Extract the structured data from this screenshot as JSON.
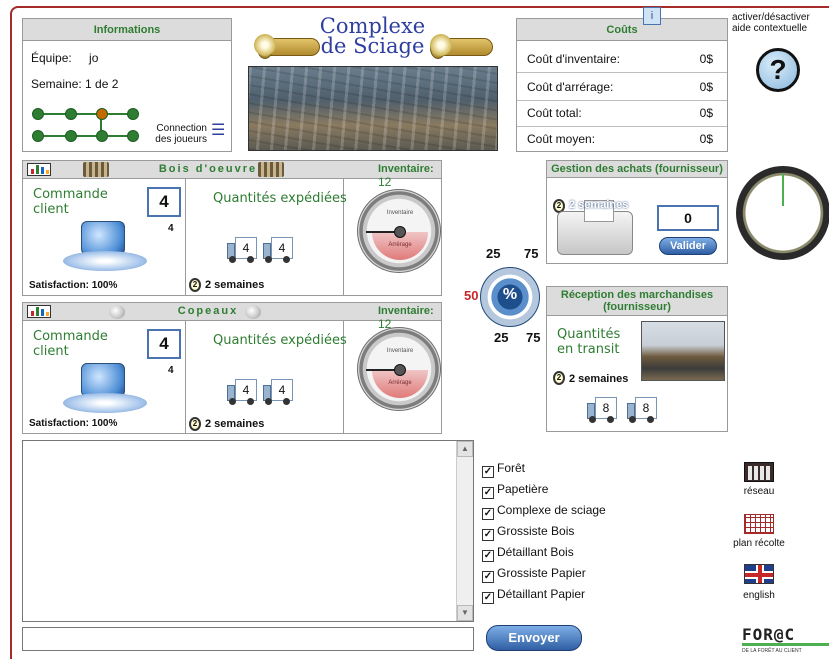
{
  "info": {
    "title": "Informations",
    "team_label": "Équipe:",
    "team": "jo",
    "week_label": "Semaine:",
    "week": "1 de 2",
    "players_link": "Connection des joueurs"
  },
  "app_title": "Complexe de Sciage",
  "costs": {
    "title": "Coûts",
    "rows": [
      {
        "label": "Coût d'inventaire:",
        "value": "0$"
      },
      {
        "label": "Coût d'arrérage:",
        "value": "0$"
      },
      {
        "label": "Coût total:",
        "value": "0$"
      },
      {
        "label": "Coût moyen:",
        "value": "0$"
      }
    ]
  },
  "help": {
    "label": "activer/désactiver aide contextuelle",
    "symbol": "?"
  },
  "products": [
    {
      "name": "Bois d'oeuvre",
      "inventory_label": "Inventaire:",
      "inventory": "12",
      "command_title": "Commande client",
      "command_value": "4",
      "command_small": "4",
      "satisfaction": "Satisfaction: 100%",
      "shipped_title": "Quantités expédiées",
      "trucks": [
        "4",
        "4"
      ],
      "delay": "2 semaines",
      "gauge_top": "Inventaire",
      "gauge_bottom": "Arrérage"
    },
    {
      "name": "Copeaux",
      "inventory_label": "Inventaire:",
      "inventory": "12",
      "command_title": "Commande client",
      "command_value": "4",
      "command_small": "4",
      "satisfaction": "Satisfaction: 100%",
      "shipped_title": "Quantités expédiées",
      "trucks": [
        "4",
        "4"
      ],
      "delay": "2 semaines",
      "gauge_top": "Inventaire",
      "gauge_bottom": "Arrérage"
    }
  ],
  "dial": {
    "symbol": "%",
    "top_left": "25",
    "top_right": "75",
    "left": "50",
    "bottom_left": "25",
    "bottom_right": "75"
  },
  "purchasing": {
    "title": "Gestion des achats (fournisseur)",
    "delay": "2 semaines",
    "order_value": "0",
    "validate": "Valider"
  },
  "receiving": {
    "title": "Réception des marchandises (fournisseur)",
    "transit_title": "Quantités en transit",
    "delay": "2 semaines",
    "trucks": [
      "8",
      "8"
    ]
  },
  "chat": {
    "send": "Envoyer",
    "input_value": ""
  },
  "recipients": [
    {
      "label": "Forêt",
      "checked": true
    },
    {
      "label": "Papetière",
      "checked": true
    },
    {
      "label": "Complexe de sciage",
      "checked": true
    },
    {
      "label": "Grossiste Bois",
      "checked": true
    },
    {
      "label": "Détaillant Bois",
      "checked": true
    },
    {
      "label": "Grossiste Papier",
      "checked": true
    },
    {
      "label": "Détaillant Papier",
      "checked": true
    }
  ],
  "side": {
    "network": "réseau",
    "harvest": "plan récolte",
    "language": "english"
  },
  "logo": {
    "text": "FOR@C",
    "tagline": "DE LA FORÊT AU CLIENT"
  },
  "colors": {
    "accent_green": "#2e7d32",
    "accent_blue": "#2f5fa3",
    "frame_red": "#a52a2a"
  }
}
